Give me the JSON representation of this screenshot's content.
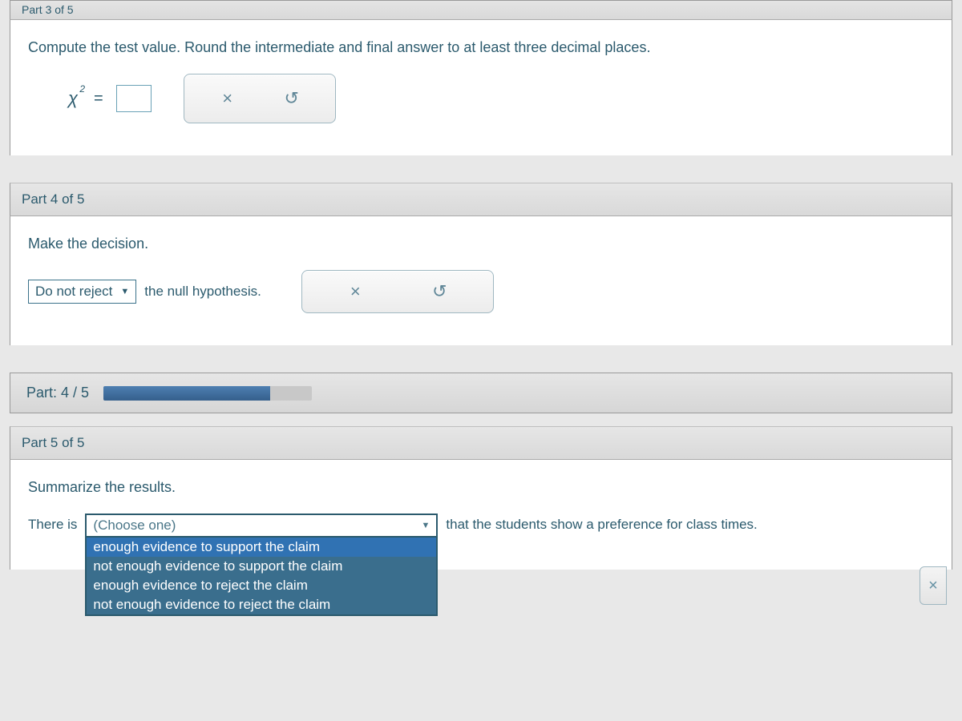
{
  "top_cut_label": "Part 3 of 5",
  "part3": {
    "instruction": "Compute the test value. Round the intermediate and final answer to at least three decimal places.",
    "chi_symbol": "χ",
    "chi_sup": "2",
    "equals": "="
  },
  "part4": {
    "header": "Part 4 of 5",
    "instruction": "Make the decision.",
    "select_value": "Do not reject",
    "trailing": "the null hypothesis."
  },
  "progress": {
    "label": "Part: 4 / 5",
    "percent": 80
  },
  "part5": {
    "header": "Part 5 of 5",
    "instruction": "Summarize the results.",
    "lead": "There is",
    "selected": "(Choose one)",
    "options": [
      "enough evidence to support the claim",
      "not enough evidence to support the claim",
      "enough evidence to reject the claim",
      "not enough evidence to reject the claim"
    ],
    "trailing": "that the students show a preference for class times."
  },
  "icons": {
    "clear": "×",
    "reset": "↺"
  }
}
